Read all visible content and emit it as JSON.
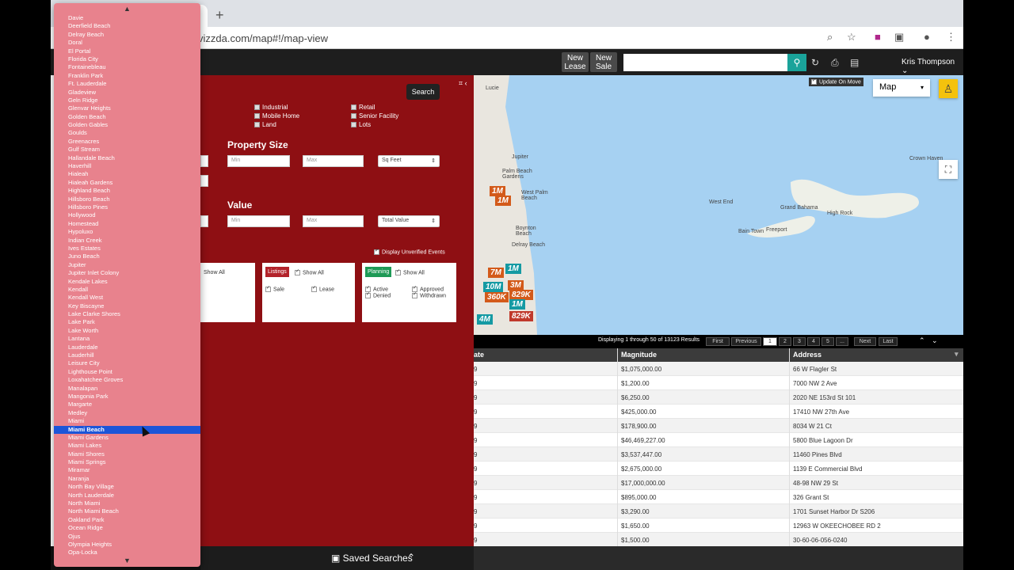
{
  "browser": {
    "url": "vizzda.com/map#!/map-view",
    "new_tab_label": "+"
  },
  "header": {
    "new_lease": "New Lease",
    "new_sale": "New Sale",
    "search_placeholder": "",
    "user_name": "Kris Thompson"
  },
  "filters": {
    "search_label": "Search",
    "property_types": [
      "Industrial",
      "Mobile Home",
      "Land",
      "Retail",
      "Senior Facility",
      "Lots"
    ],
    "property_size_heading": "Property Size",
    "value_heading": "Value",
    "min_placeholder": "Min",
    "max_placeholder": "Max",
    "size_unit": "Sq Feet",
    "value_type": "Total Value",
    "display_unverified": "Display Unverified Events",
    "show_all": "Show All",
    "listings": {
      "tag": "Listings",
      "sale": "Sale",
      "lease": "Lease"
    },
    "planning": {
      "tag": "Planning",
      "active": "Active",
      "denied": "Denied",
      "approved": "Approved",
      "withdrawn": "Withdrawn"
    }
  },
  "map": {
    "type": "Map",
    "update_on_move": "Update On Move",
    "labels": [
      "Lucie",
      "Jupiter",
      "Palm Beach Gardens",
      "West Palm Beach",
      "Boynton Beach",
      "Delray Beach",
      "West End",
      "Grand Bahama",
      "High Rock",
      "Freeport",
      "Bain Town",
      "Crown Haven"
    ],
    "markers": [
      "7M",
      "10M",
      "360K",
      "4M",
      "1M",
      "3M",
      "829K"
    ],
    "zoom_in": "+",
    "zoom_out": "−"
  },
  "pagination": {
    "summary": "Displaying 1 through 50 of 13123 Results",
    "first": "First",
    "previous": "Previous",
    "pages": [
      "1",
      "2",
      "3",
      "4",
      "5",
      "..."
    ],
    "next": "Next",
    "last": "Last"
  },
  "table": {
    "columns": [
      "ate",
      "Magnitude",
      "Address"
    ],
    "rows": [
      [
        "9",
        "$1,075,000.00",
        "66 W Flagler St"
      ],
      [
        "9",
        "$1,200.00",
        "7000 NW 2 Ave"
      ],
      [
        "9",
        "$6,250.00",
        "2020 NE 153rd St 101"
      ],
      [
        "9",
        "$425,000.00",
        "17410 NW 27th Ave"
      ],
      [
        "9",
        "$178,900.00",
        "8034 W 21 Ct"
      ],
      [
        "9",
        "$46,469,227.00",
        "5800 Blue Lagoon Dr"
      ],
      [
        "9",
        "$3,537,447.00",
        "11460 Pines Blvd"
      ],
      [
        "9",
        "$2,675,000.00",
        "1139 E Commercial Blvd"
      ],
      [
        "9",
        "$17,000,000.00",
        "48-98 NW 29 St"
      ],
      [
        "9",
        "$895,000.00",
        "326 Grant St"
      ],
      [
        "9",
        "$3,290.00",
        "1701 Sunset Harbor Dr S206"
      ],
      [
        "9",
        "$1,650.00",
        "12963 W OKEECHOBEE RD 2"
      ],
      [
        "9",
        "$1,500.00",
        "30-60-06-056-0240"
      ]
    ]
  },
  "footer": {
    "saved_searches": "Saved Searches"
  },
  "city_dropdown": {
    "selected": "Miami Beach",
    "items": [
      "Davie",
      "Deerfield Beach",
      "Delray Beach",
      "Doral",
      "El Portal",
      "Florida City",
      "Fontainebleau",
      "Franklin Park",
      "Ft. Lauderdale",
      "Gladeview",
      "Geln Ridge",
      "Glenvar Heights",
      "Golden Beach",
      "Golden Gables",
      "Goulds",
      "Greenacres",
      "Gulf Stream",
      "Hallandale Beach",
      "Haverhill",
      "Hialeah",
      "Hialeah Gardens",
      "Highland Beach",
      "Hillsboro Beach",
      "Hillsboro Pines",
      "Hollywood",
      "Homestead",
      "Hypoluxo",
      "Indian Creek",
      "Ives Estates",
      "Juno Beach",
      "Jupiter",
      "Jupiter Inlet Colony",
      "Kendale Lakes",
      "Kendall",
      "Kendall West",
      "Key Biscayne",
      "Lake Clarke Shores",
      "Lake Park",
      "Lake Worth",
      "Lantana",
      "Lauderdale",
      "Lauderhill",
      "Leisure City",
      "Lighthouse Point",
      "Loxahatchee Groves",
      "Manalapan",
      "Mangonia Park",
      "Margarte",
      "Medley",
      "Miami",
      "Miami Beach",
      "Miami Gardens",
      "Miami Lakes",
      "Miami Shores",
      "Miami Springs",
      "Miramar",
      "Naranja",
      "North Bay Village",
      "North Lauderdale",
      "North Miami",
      "North Miami Beach",
      "Oakland Park",
      "Ocean Ridge",
      "Ojus",
      "Olympia Heights",
      "Opa-Locka"
    ]
  }
}
